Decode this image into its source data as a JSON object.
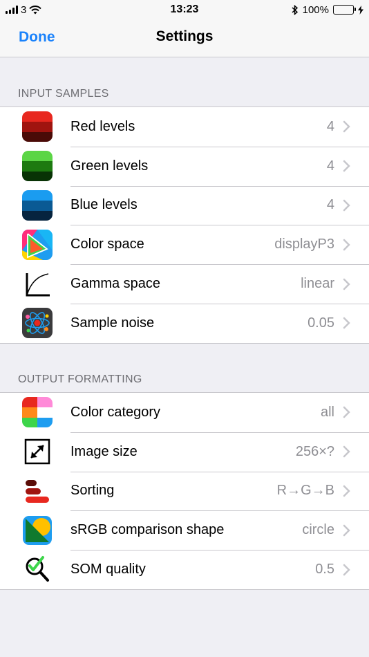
{
  "status_bar": {
    "carrier": "3",
    "time": "13:23",
    "battery": "100%"
  },
  "nav": {
    "done_label": "Done",
    "title": "Settings"
  },
  "sections": [
    {
      "header": "INPUT SAMPLES",
      "rows": [
        {
          "label": "Red levels",
          "value": "4",
          "icon": "red-levels-icon"
        },
        {
          "label": "Green levels",
          "value": "4",
          "icon": "green-levels-icon"
        },
        {
          "label": "Blue levels",
          "value": "4",
          "icon": "blue-levels-icon"
        },
        {
          "label": "Color space",
          "value": "displayP3",
          "icon": "color-space-icon"
        },
        {
          "label": "Gamma space",
          "value": "linear",
          "icon": "gamma-curve-icon"
        },
        {
          "label": "Sample noise",
          "value": "0.05",
          "icon": "atom-noise-icon"
        }
      ]
    },
    {
      "header": "OUTPUT FORMATTING",
      "rows": [
        {
          "label": "Color category",
          "value": "all",
          "icon": "color-category-icon"
        },
        {
          "label": "Image size",
          "value": "256×?",
          "icon": "resize-arrows-icon"
        },
        {
          "label": "Sorting",
          "value": "R→G→B",
          "icon": "sorting-bars-icon"
        },
        {
          "label": "sRGB comparison shape",
          "value": "circle",
          "icon": "comparison-shape-icon"
        },
        {
          "label": "SOM quality",
          "value": "0.5",
          "icon": "magnifier-check-icon"
        }
      ]
    }
  ],
  "colors": {
    "accent": "#1a82fb",
    "secondary_text": "#8e8e93",
    "background": "#efeff4"
  }
}
